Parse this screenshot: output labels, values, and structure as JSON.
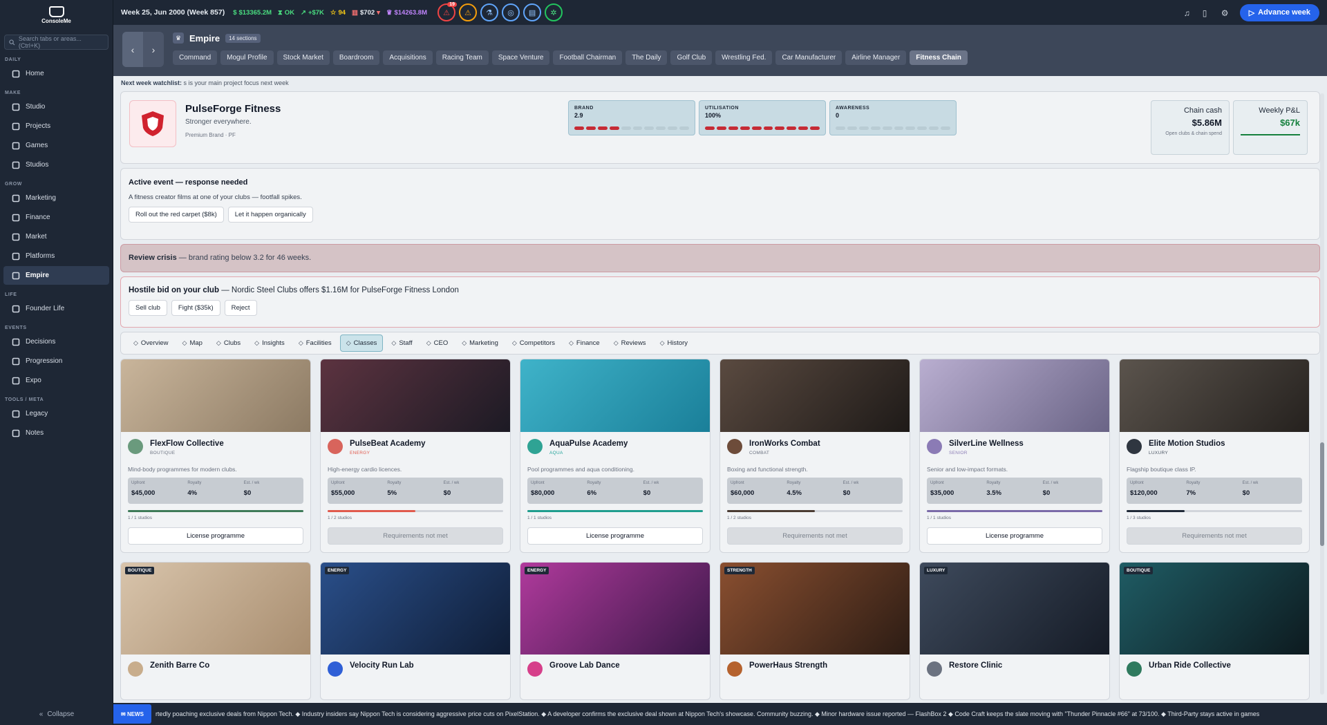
{
  "sidebar": {
    "logo": "ConsoleMe",
    "search_placeholder": "Search tabs or areas... (Ctrl+K)",
    "sections": [
      {
        "title": "DAILY",
        "items": [
          {
            "label": "Home",
            "icon": "grid-icon"
          }
        ]
      },
      {
        "title": "MAKE",
        "items": [
          {
            "label": "Studio",
            "icon": "grid-icon"
          },
          {
            "label": "Projects",
            "icon": "folder-icon"
          },
          {
            "label": "Games",
            "icon": "gamepad-icon"
          },
          {
            "label": "Studios",
            "icon": "briefcase-icon"
          }
        ]
      },
      {
        "title": "GROW",
        "items": [
          {
            "label": "Marketing",
            "icon": "megaphone-icon"
          },
          {
            "label": "Finance",
            "icon": "bank-icon"
          },
          {
            "label": "Market",
            "icon": "globe-icon"
          },
          {
            "label": "Platforms",
            "icon": "grid-icon"
          },
          {
            "label": "Empire",
            "icon": "crown-icon",
            "active": true
          }
        ]
      },
      {
        "title": "LIFE",
        "items": [
          {
            "label": "Founder Life",
            "icon": "sparkle-icon"
          }
        ]
      },
      {
        "title": "EVENTS",
        "items": [
          {
            "label": "Decisions",
            "icon": "warning-icon"
          },
          {
            "label": "Progression",
            "icon": "flask-icon"
          },
          {
            "label": "Expo",
            "icon": "presentation-icon"
          }
        ]
      },
      {
        "title": "TOOLS / META",
        "items": [
          {
            "label": "Legacy",
            "icon": "book-icon"
          },
          {
            "label": "Notes",
            "icon": "notes-icon"
          }
        ]
      }
    ],
    "collapse": "Collapse"
  },
  "topbar": {
    "week": "Week 25, Jun 2000 (Week 857)",
    "cash": "$13365.2M",
    "status": "OK",
    "trend": "+$7K",
    "stars": "94",
    "shares": "$702",
    "networth": "$14263.8M",
    "alert_count": "19",
    "advance": "Advance week"
  },
  "header": {
    "title": "Empire",
    "sections": "14 sections",
    "tabs": [
      "Command",
      "Mogul Profile",
      "Stock Market",
      "Boardroom",
      "Acquisitions",
      "Racing Team",
      "Space Venture",
      "Football Chairman",
      "The Daily",
      "Golf Club",
      "Wrestling Fed.",
      "Car Manufacturer",
      "Airline Manager",
      "Fitness Chain"
    ],
    "active_tab": "Fitness Chain",
    "watchlist_label": "Next week watchlist:",
    "watchlist_text": "s is your main project focus next week"
  },
  "club": {
    "name": "PulseForge Fitness",
    "tagline": "Stronger everywhere.",
    "sub": "Premium Brand · PF",
    "metrics": [
      {
        "label": "BRAND",
        "value": "2.9",
        "fill": 0.4
      },
      {
        "label": "UTILISATION",
        "value": "100%",
        "fill": 1.0
      },
      {
        "label": "AWARENESS",
        "value": "0",
        "fill": 0
      }
    ],
    "chain_cash_label": "Chain cash",
    "chain_cash": "$5.86M",
    "chain_cash_sub": "Open clubs & chain spend",
    "pnl_label": "Weekly P&L",
    "pnl": "$67k"
  },
  "event": {
    "title": "Active event — response needed",
    "text": "A fitness creator films at one of your clubs — footfall spikes.",
    "options": [
      "Roll out the red carpet ($8k)",
      "Let it happen organically"
    ]
  },
  "crisis": {
    "title": "Review crisis",
    "text": "— brand rating below 3.2 for 46 weeks."
  },
  "hostile": {
    "title": "Hostile bid on your club",
    "text": "— Nordic Steel Clubs offers $1.16M for PulseForge Fitness London",
    "options": [
      "Sell club",
      "Fight ($35k)",
      "Reject"
    ]
  },
  "subtabs": [
    {
      "label": "Overview",
      "icon": "pulse-icon"
    },
    {
      "label": "Map",
      "icon": "map-icon"
    },
    {
      "label": "Clubs",
      "icon": "building-icon"
    },
    {
      "label": "Insights",
      "icon": "trend-icon"
    },
    {
      "label": "Facilities",
      "icon": "dumbbell-icon"
    },
    {
      "label": "Classes",
      "icon": "users-icon",
      "active": true
    },
    {
      "label": "Staff",
      "icon": "gear-icon"
    },
    {
      "label": "CEO",
      "icon": "person-icon"
    },
    {
      "label": "Marketing",
      "icon": "megaphone-icon"
    },
    {
      "label": "Competitors",
      "icon": "target-icon"
    },
    {
      "label": "Finance",
      "icon": "wallet-icon"
    },
    {
      "label": "Reviews",
      "icon": "chat-icon"
    },
    {
      "label": "History",
      "icon": "history-icon"
    }
  ],
  "programmes": [
    {
      "name": "FlexFlow Collective",
      "type": "BOUTIQUE",
      "type_color": "#6b7280",
      "dot": "#6a9a7d",
      "desc": "Mind-body programmes for modern clubs.",
      "upfront": "$45,000",
      "royalty": "4%",
      "est": "$0",
      "studios": "1 / 1 studios",
      "progress": 1.0,
      "bar": "#3e7a58",
      "action": "License programme",
      "ok": true,
      "img": [
        "#c9b59b",
        "#8c7a63"
      ]
    },
    {
      "name": "PulseBeat Academy",
      "type": "ENERGY",
      "type_color": "#e05a4d",
      "dot": "#d8645c",
      "desc": "High-energy cardio licences.",
      "upfront": "$55,000",
      "royalty": "5%",
      "est": "$0",
      "studios": "1 / 2 studios",
      "progress": 0.5,
      "bar": "#e05a4d",
      "action": "Requirements not met",
      "ok": false,
      "img": [
        "#5c3340",
        "#1c1a24"
      ]
    },
    {
      "name": "AquaPulse Academy",
      "type": "AQUA",
      "type_color": "#22a39a",
      "dot": "#2fa394",
      "desc": "Pool programmes and aqua conditioning.",
      "upfront": "$80,000",
      "royalty": "6%",
      "est": "$0",
      "studios": "1 / 1 studios",
      "progress": 1.0,
      "bar": "#1f9d8e",
      "action": "License programme",
      "ok": true,
      "img": [
        "#3fb3c9",
        "#1a7f99"
      ]
    },
    {
      "name": "IronWorks Combat",
      "type": "COMBAT",
      "type_color": "#6b7280",
      "dot": "#6d4c3a",
      "desc": "Boxing and functional strength.",
      "upfront": "$60,000",
      "royalty": "4.5%",
      "est": "$0",
      "studios": "1 / 2 studios",
      "progress": 0.5,
      "bar": "#4a3b32",
      "action": "Requirements not met",
      "ok": false,
      "img": [
        "#5a4a40",
        "#1e1a18"
      ]
    },
    {
      "name": "SilverLine Wellness",
      "type": "SENIOR",
      "type_color": "#8b7bb5",
      "dot": "#8b7bb5",
      "desc": "Senior and low-impact formats.",
      "upfront": "$35,000",
      "royalty": "3.5%",
      "est": "$0",
      "studios": "1 / 1 studios",
      "progress": 1.0,
      "bar": "#7a6aa8",
      "action": "License programme",
      "ok": true,
      "img": [
        "#b9aed0",
        "#6a6486"
      ]
    },
    {
      "name": "Elite Motion Studios",
      "type": "LUXURY",
      "type_color": "#4b5563",
      "dot": "#2f3640",
      "desc": "Flagship boutique class IP.",
      "upfront": "$120,000",
      "royalty": "7%",
      "est": "$0",
      "studios": "1 / 3 studios",
      "progress": 0.33,
      "bar": "#1f2937",
      "action": "Requirements not met",
      "ok": false,
      "img": [
        "#5b544d",
        "#25211e"
      ]
    },
    {
      "name": "Zenith Barre Co",
      "tag": "BOUTIQUE",
      "dot": "#c8ad8c",
      "img": [
        "#d8c4ab",
        "#a88d6f"
      ]
    },
    {
      "name": "Velocity Run Lab",
      "tag": "ENERGY",
      "dot": "#2f5fd6",
      "img": [
        "#2a4f8a",
        "#0f1d36"
      ]
    },
    {
      "name": "Groove Lab Dance",
      "tag": "ENERGY",
      "dot": "#d63f8a",
      "img": [
        "#b03a9c",
        "#3a1848"
      ]
    },
    {
      "name": "PowerHaus Strength",
      "tag": "STRENGTH",
      "dot": "#b5622e",
      "img": [
        "#8a4f30",
        "#2c1c14"
      ]
    },
    {
      "name": "Restore Clinic",
      "tag": "LUXURY",
      "dot": "#6b7280",
      "img": [
        "#3e4a5c",
        "#151b26"
      ]
    },
    {
      "name": "Urban Ride Collective",
      "tag": "BOUTIQUE",
      "dot": "#2f7a5e",
      "img": [
        "#1f5c64",
        "#0d1a1f"
      ]
    }
  ],
  "terms_labels": {
    "upfront": "Upfront",
    "royalty": "Royalty",
    "est": "Est. / wk"
  },
  "ticker": {
    "label": "NEWS",
    "text": "rtedly poaching exclusive deals from Nippon Tech. ◆ Industry insiders say Nippon Tech is considering aggressive price cuts on PixelStation. ◆ A developer confirms the exclusive deal shown at Nippon Tech's showcase. Community buzzing. ◆ Minor hardware issue reported — FlashBox 2 ◆ Code Craft keeps the slate moving with \"Thunder Pinnacle #66\" at 73/100. ◆ Third-Party stays active in games"
  }
}
